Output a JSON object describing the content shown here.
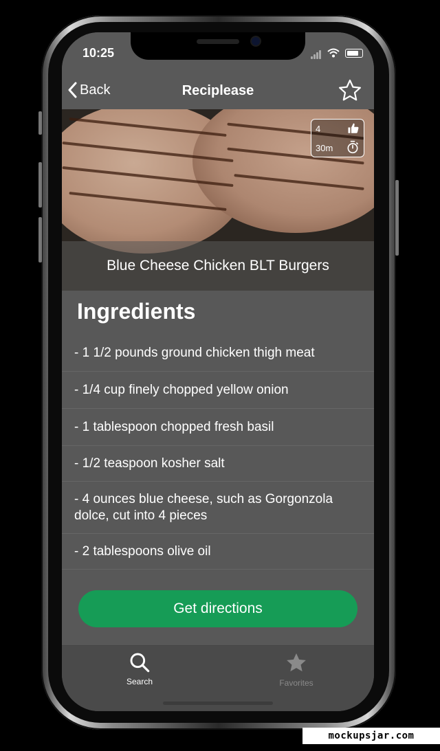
{
  "status_bar": {
    "time": "10:25"
  },
  "nav": {
    "back_label": "Back",
    "title": "Reciplease",
    "favorite_icon": "star-outline-icon"
  },
  "recipe": {
    "title": "Blue Cheese Chicken BLT Burgers",
    "likes": "4",
    "duration": "30m",
    "likes_icon": "thumbs-up-icon",
    "duration_icon": "stopwatch-icon"
  },
  "ingredients": {
    "heading": "Ingredients",
    "items": [
      "- 1 1/2 pounds ground chicken thigh meat",
      "- 1/4 cup finely chopped yellow onion",
      "- 1 tablespoon chopped fresh basil",
      "- 1/2 teaspoon kosher salt",
      "- 4 ounces blue cheese, such as Gorgonzola dolce, cut into 4 pieces",
      "- 2 tablespoons olive oil"
    ]
  },
  "actions": {
    "directions_label": "Get directions"
  },
  "tabs": [
    {
      "label": "Search",
      "icon": "search-icon",
      "active": true
    },
    {
      "label": "Favorites",
      "icon": "star-icon",
      "active": false
    }
  ],
  "colors": {
    "accent_green": "#169c56",
    "active_tab": "#ffffff",
    "inactive_tab": "#8a8a8a"
  },
  "watermark": "mockupsjar.com"
}
